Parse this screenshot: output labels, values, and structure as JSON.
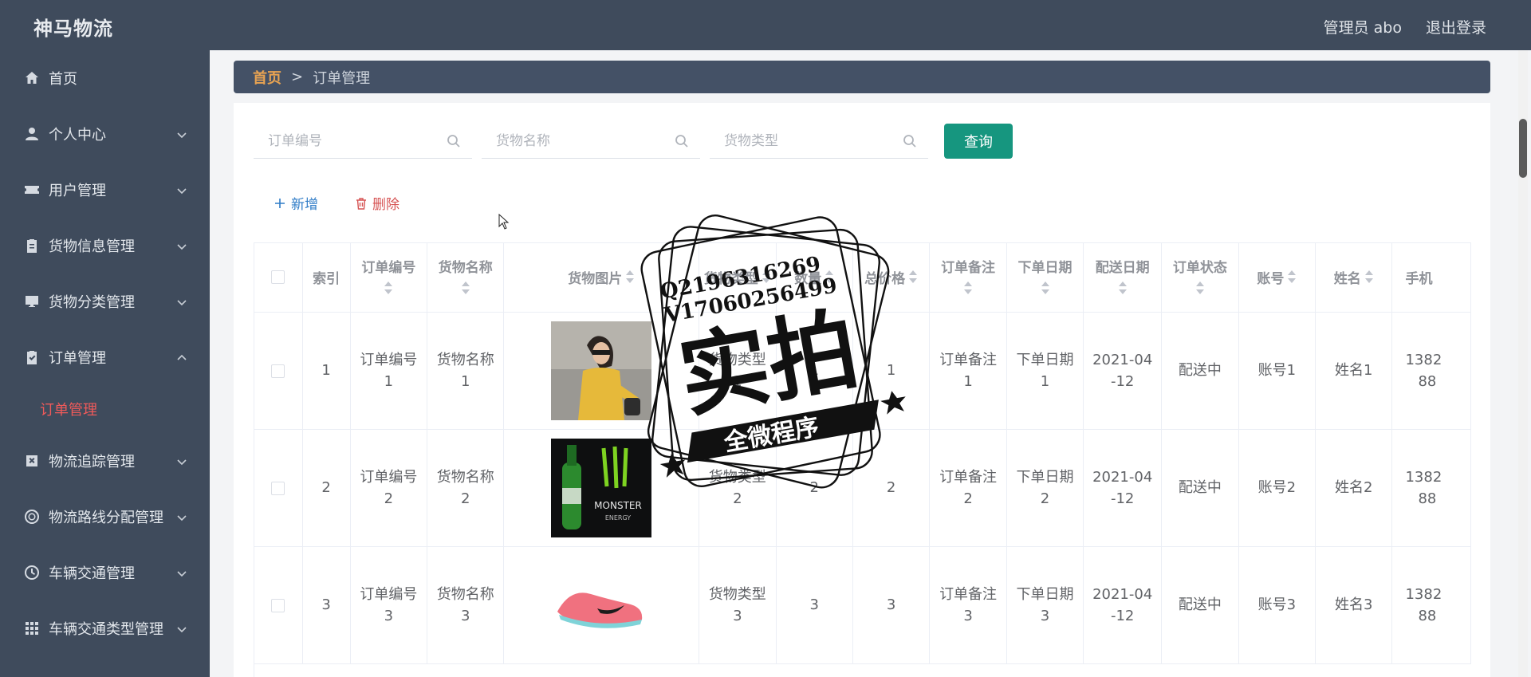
{
  "header": {
    "brand": "神马物流",
    "admin_label": "管理员 abo",
    "logout_label": "退出登录"
  },
  "sidebar": {
    "items": [
      {
        "label": "首页",
        "icon": "home-icon",
        "has_chevron": false
      },
      {
        "label": "个人中心",
        "icon": "user-icon",
        "has_chevron": true
      },
      {
        "label": "用户管理",
        "icon": "ticket-icon",
        "has_chevron": true
      },
      {
        "label": "货物信息管理",
        "icon": "clipboard-icon",
        "has_chevron": true
      },
      {
        "label": "货物分类管理",
        "icon": "monitor-icon",
        "has_chevron": true
      },
      {
        "label": "订单管理",
        "icon": "clipboard-check-icon",
        "has_chevron": true,
        "expanded": true
      },
      {
        "label": "物流追踪管理",
        "icon": "box-x-icon",
        "has_chevron": true
      },
      {
        "label": "物流路线分配管理",
        "icon": "ring-icon",
        "has_chevron": true
      },
      {
        "label": "车辆交通管理",
        "icon": "clock-icon",
        "has_chevron": true
      },
      {
        "label": "车辆交通类型管理",
        "icon": "grid-icon",
        "has_chevron": true
      }
    ],
    "subitem": "订单管理"
  },
  "breadcrumb": {
    "home": "首页",
    "separator": ">",
    "current": "订单管理"
  },
  "search": {
    "order_no_placeholder": "订单编号",
    "goods_name_placeholder": "货物名称",
    "goods_type_placeholder": "货物类型",
    "query_label": "查询"
  },
  "actions": {
    "add_label": "新增",
    "delete_label": "删除"
  },
  "table": {
    "headers": [
      "索引",
      "订单编号",
      "货物名称",
      "货物图片",
      "货物类型",
      "数量",
      "总价格",
      "订单备注",
      "下单日期",
      "配送日期",
      "订单状态",
      "账号",
      "姓名",
      "手机"
    ],
    "rows": [
      {
        "index": "1",
        "order_no": [
          "订单编号",
          "1"
        ],
        "goods_name": [
          "货物名称",
          "1"
        ],
        "goods_type": [
          "货物类型",
          "1"
        ],
        "qty": "1",
        "total": "1",
        "remark": [
          "订单备注",
          "1"
        ],
        "order_date": [
          "下单日期",
          "1"
        ],
        "ship_date": [
          "2021-04",
          "-12"
        ],
        "status": "配送中",
        "account": "账号1",
        "name": "姓名1",
        "phone": [
          "1382",
          "88"
        ]
      },
      {
        "index": "2",
        "order_no": [
          "订单编号",
          "2"
        ],
        "goods_name": [
          "货物名称",
          "2"
        ],
        "goods_type": [
          "货物类型",
          "2"
        ],
        "qty": "2",
        "total": "2",
        "remark": [
          "订单备注",
          "2"
        ],
        "order_date": [
          "下单日期",
          "2"
        ],
        "ship_date": [
          "2021-04",
          "-12"
        ],
        "status": "配送中",
        "account": "账号2",
        "name": "姓名2",
        "phone": [
          "1382",
          "88"
        ]
      },
      {
        "index": "3",
        "order_no": [
          "订单编号",
          "3"
        ],
        "goods_name": [
          "货物名称",
          "3"
        ],
        "goods_type": [
          "货物类型",
          "3"
        ],
        "qty": "3",
        "total": "3",
        "remark": [
          "订单备注",
          "3"
        ],
        "order_date": [
          "下单日期",
          "3"
        ],
        "ship_date": [
          "2021-04",
          "-12"
        ],
        "status": "配送中",
        "account": "账号3",
        "name": "姓名3",
        "phone": [
          "1382",
          "88"
        ]
      }
    ]
  },
  "watermark": {
    "line1": "Q2196316269",
    "line2": "V17060256499",
    "big": "实拍",
    "banner": "全微程序"
  },
  "colors": {
    "sidebar_bg": "#3f4b5c",
    "active_sub": "#ef5a5a",
    "query_btn": "#16967f",
    "breadcrumb_home": "#e8a352",
    "add": "#2f7cc7",
    "delete": "#d65454"
  }
}
